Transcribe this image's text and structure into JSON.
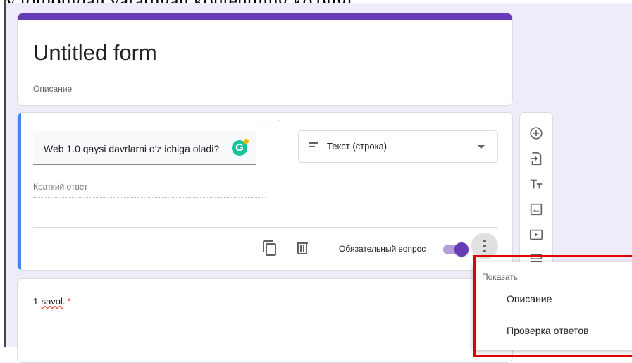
{
  "form": {
    "title": "Untitled form",
    "description_placeholder": "Описание"
  },
  "question1": {
    "text": "Web 1.0 qaysi davrlarni o'z ichiga oladi?",
    "type_label": "Текст (строка)",
    "answer_placeholder": "Краткий ответ",
    "required_label": "Обязательный вопрос",
    "required_on": true
  },
  "question2": {
    "number": "1-",
    "word": "savol",
    "suffix": ".",
    "required_mark": "*"
  },
  "menu": {
    "header": "Показать",
    "items": [
      "Описание",
      "Проверка ответов"
    ]
  },
  "toolbar": {
    "icons": [
      "add-question-icon",
      "import-questions-icon",
      "add-title-icon",
      "add-image-icon",
      "add-video-icon",
      "add-section-icon"
    ]
  },
  "colors": {
    "accent": "#673ab7",
    "focus": "#4285f4",
    "grammarly": "#15c39a",
    "highlight": "#e00000"
  }
}
